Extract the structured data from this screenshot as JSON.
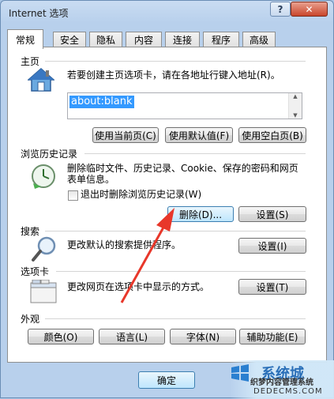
{
  "window": {
    "title": "Internet 选项",
    "help": "?",
    "close": "✕"
  },
  "tabs": [
    "常规",
    "安全",
    "隐私",
    "内容",
    "连接",
    "程序",
    "高级"
  ],
  "homepage": {
    "title": "主页",
    "desc": "若要创建主页选项卡，请在各地址行键入地址(R)。",
    "url": "about:blank",
    "buttons": [
      "使用当前页(C)",
      "使用默认值(F)",
      "使用空白页(B)"
    ]
  },
  "history": {
    "title": "浏览历史记录",
    "desc1": "删除临时文件、历史记录、Cookie、保存的密码和网页",
    "desc2": "表单信息。",
    "checkbox": "退出时删除浏览历史记录(W)",
    "delete": "删除(D)...",
    "settings": "设置(S)"
  },
  "search": {
    "title": "搜索",
    "desc": "更改默认的搜索提供程序。",
    "settings": "设置(I)"
  },
  "tabsection": {
    "title": "选项卡",
    "desc": "更改网页在选项卡中显示的方式。",
    "settings": "设置(T)"
  },
  "appearance": {
    "title": "外观",
    "buttons": [
      "颜色(O)",
      "语言(L)",
      "字体(N)",
      "辅助功能(E)"
    ]
  },
  "footer": {
    "ok": "确定"
  },
  "watermark": {
    "big": "系统城",
    "sub": "织梦内容管理系统",
    "url": "DEDECMS.COM"
  },
  "colors": {
    "accent": "#3399ff",
    "arrow": "#e8372a"
  }
}
